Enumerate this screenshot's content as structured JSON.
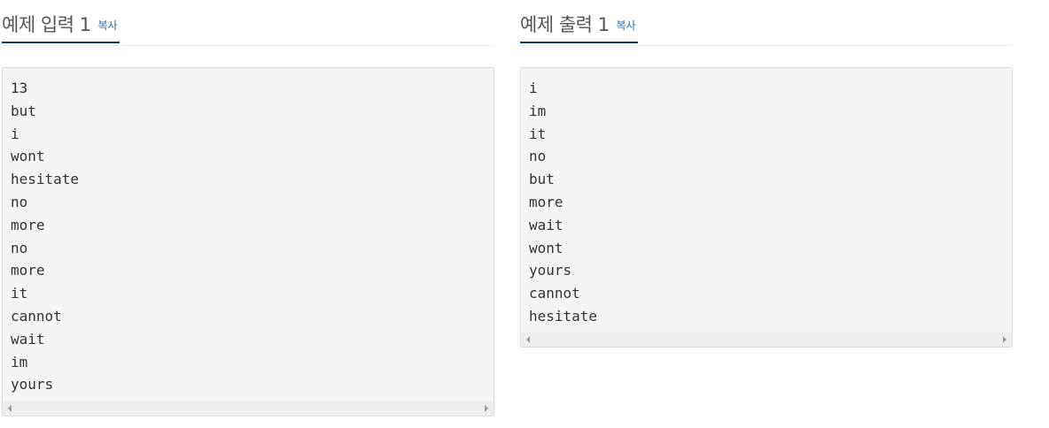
{
  "input_panel": {
    "title": "예제 입력 1",
    "copy_label": "복사",
    "lines": [
      "13",
      "but",
      "i",
      "wont",
      "hesitate",
      "no",
      "more",
      "no",
      "more",
      "it",
      "cannot",
      "wait",
      "im",
      "yours"
    ]
  },
  "output_panel": {
    "title": "예제 출력 1",
    "copy_label": "복사",
    "lines": [
      "i",
      "im",
      "it",
      "no",
      "but",
      "more",
      "wait",
      "wont",
      "yours",
      "cannot",
      "hesitate"
    ]
  },
  "colors": {
    "accent_underline": "#0d3a6a",
    "link": "#2a6ba3",
    "code_background": "#f5f5f7"
  }
}
